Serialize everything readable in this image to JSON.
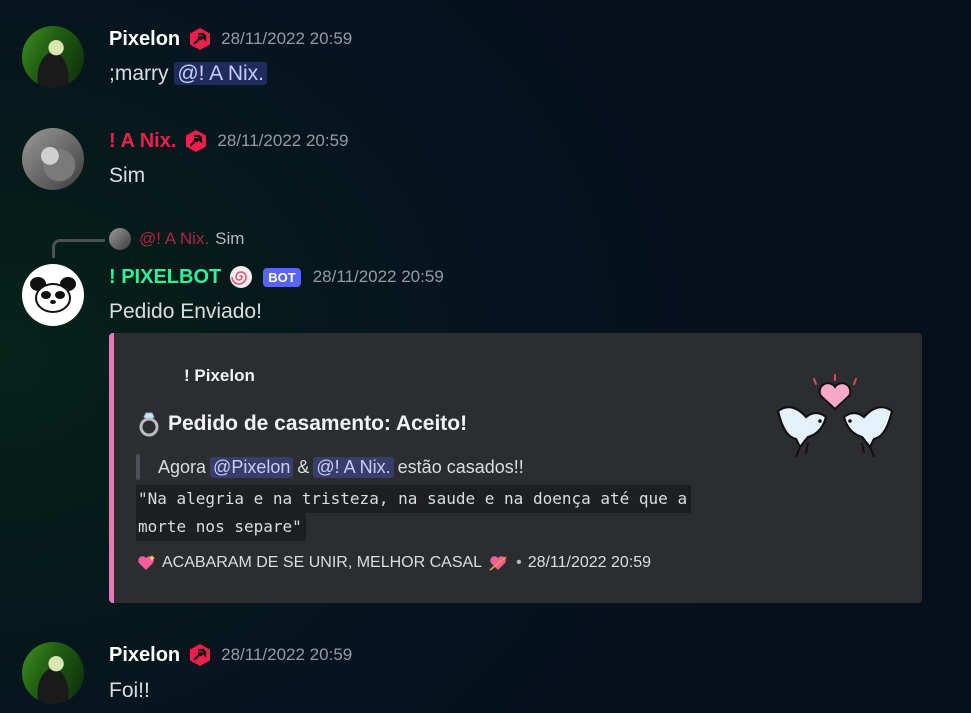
{
  "messages": {
    "m1": {
      "username": "Pixelon",
      "username_color": "#ffffff",
      "timestamp": "28/11/2022 20:59",
      "command": ";marry",
      "mention": "@! A Nix."
    },
    "m2": {
      "username": "! A Nix.",
      "username_color": "#ed1f4f",
      "timestamp": "28/11/2022 20:59",
      "text": "Sim"
    },
    "m3": {
      "reply_to_name": "@! A Nix.",
      "reply_to_text": "Sim",
      "username": "! PIXELBOT",
      "username_color": "#2ef29a",
      "bot_tag": "BOT",
      "timestamp": "28/11/2022 20:59",
      "text": "Pedido Enviado!",
      "embed": {
        "accent_color": "#e57ab4",
        "author": "! Pixelon",
        "title": "Pedido de casamento: Aceito!",
        "quote_prefix": "Agora",
        "mention_1": "@Pixelon",
        "quote_joiner": "&",
        "mention_2": "@! A Nix.",
        "quote_suffix": "estão casados!!",
        "code_line_1": "\"Na alegria e na tristeza, na saude e na doença até que a",
        "code_line_2": "morte nos separe\"",
        "footer_text": "ACABARAM DE SE UNIR, MELHOR CASAL",
        "footer_sep": "•",
        "footer_timestamp": "28/11/2022 20:59"
      }
    },
    "m4": {
      "username": "Pixelon",
      "username_color": "#ffffff",
      "timestamp": "28/11/2022 20:59",
      "text": "Foi!!"
    }
  },
  "icons": {
    "role_badge": "hammer-wrench-badge-icon",
    "bot_avatar": "panda-icon",
    "bot_badge": "swirl-badge-icon",
    "ring": "ring-icon",
    "sparkling_heart": "sparkling-heart-icon",
    "arrow_heart": "heart-with-arrow-icon",
    "doves": "doves-heart-icon"
  },
  "colors": {
    "mention_bg": "#3b4378",
    "bot_tag": "#5865f2",
    "embed_bg": "#2b2d31"
  }
}
